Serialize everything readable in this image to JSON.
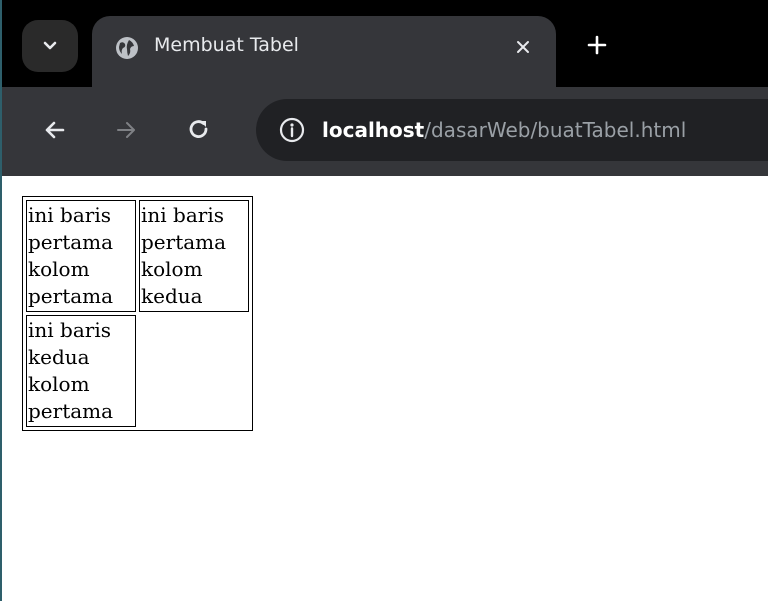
{
  "browser": {
    "tab": {
      "title": "Membuat Tabel",
      "favicon": "globe-icon"
    },
    "address": {
      "host": "localhost",
      "path": "/dasarWeb/buatTabel.html"
    },
    "icons": {
      "tab_search": "chevron-down-icon",
      "close": "close-icon",
      "new_tab": "plus-icon",
      "back": "arrow-left-icon",
      "forward": "arrow-right-icon",
      "reload": "reload-icon",
      "site_info": "info-icon"
    },
    "colors": {
      "tabstrip": "#000000",
      "toolbar": "#35363a",
      "omnibox": "#202124"
    }
  },
  "table": {
    "rows": [
      [
        "ini baris pertama kolom pertama",
        "ini baris pertama kolom kedua"
      ],
      [
        "ini baris kedua kolom pertama"
      ]
    ]
  }
}
